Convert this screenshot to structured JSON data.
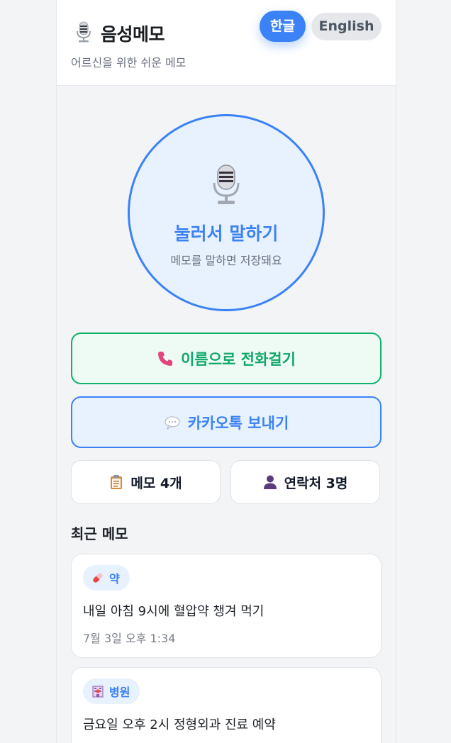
{
  "header": {
    "title": "음성메모",
    "subtitle": "어르신을 위한 쉬운 메모",
    "lang_korean": "한글",
    "lang_english": "English"
  },
  "record": {
    "label": "눌러서 말하기",
    "hint": "메모를 말하면 저장돼요"
  },
  "actions": {
    "call_label": "이름으로 전화걸기",
    "kakao_label": "카카오톡 보내기"
  },
  "stats": {
    "memos": "메모 4개",
    "contacts": "연락처 3명"
  },
  "recent": {
    "title": "최근 메모",
    "items": [
      {
        "tag": "약",
        "icon": "pill-icon",
        "text": "내일 아침 9시에 혈압약 챙겨 먹기",
        "time": "7월 3일 오후 1:34"
      },
      {
        "tag": "병원",
        "icon": "hospital-icon",
        "text": "금요일 오후 2시 정형외과 진료 예약",
        "time": ""
      }
    ]
  },
  "colors": {
    "primary": "#3b82f6",
    "success": "#10b16b",
    "background": "#f2f4f6"
  }
}
